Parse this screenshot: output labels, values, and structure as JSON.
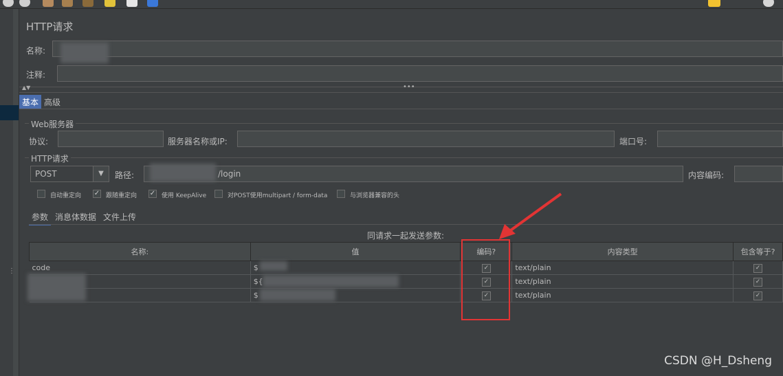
{
  "title": "HTTP请求",
  "name_label": "名称:",
  "comment_label": "注释:",
  "tabs": [
    "基本",
    "高级"
  ],
  "web_server": {
    "legend": "Web服务器",
    "protocol_label": "协议:",
    "server_label": "服务器名称或IP:",
    "port_label": "端口号:"
  },
  "http_request": {
    "legend": "HTTP请求",
    "method": "POST",
    "path_label": "路径:",
    "path_value": "/login",
    "encoding_label": "内容编码:"
  },
  "options": [
    {
      "label": "自动重定向",
      "checked": false
    },
    {
      "label": "跟随重定向",
      "checked": true
    },
    {
      "label": "使用 KeepAlive",
      "checked": true
    },
    {
      "label": "对POST使用multipart / form-data",
      "checked": false
    },
    {
      "label": "与浏览器兼容的头",
      "checked": false
    }
  ],
  "sub_tabs": [
    "参数",
    "消息体数据",
    "文件上传"
  ],
  "params_caption": "同请求一起发送参数:",
  "table": {
    "headers": [
      "名称:",
      "值",
      "编码?",
      "内容类型",
      "包含等于?"
    ],
    "rows": [
      {
        "name": "code",
        "value": "$",
        "encode": true,
        "content_type": "text/plain",
        "include_equals": true
      },
      {
        "name": "",
        "value": "${",
        "encode": true,
        "content_type": "text/plain",
        "include_equals": true
      },
      {
        "name": "",
        "value": "$",
        "encode": true,
        "content_type": "text/plain",
        "include_equals": true
      }
    ]
  },
  "watermark": "CSDN @H_Dsheng",
  "colors": {
    "accent": "#4b6eaf",
    "highlight": "#e23434"
  }
}
